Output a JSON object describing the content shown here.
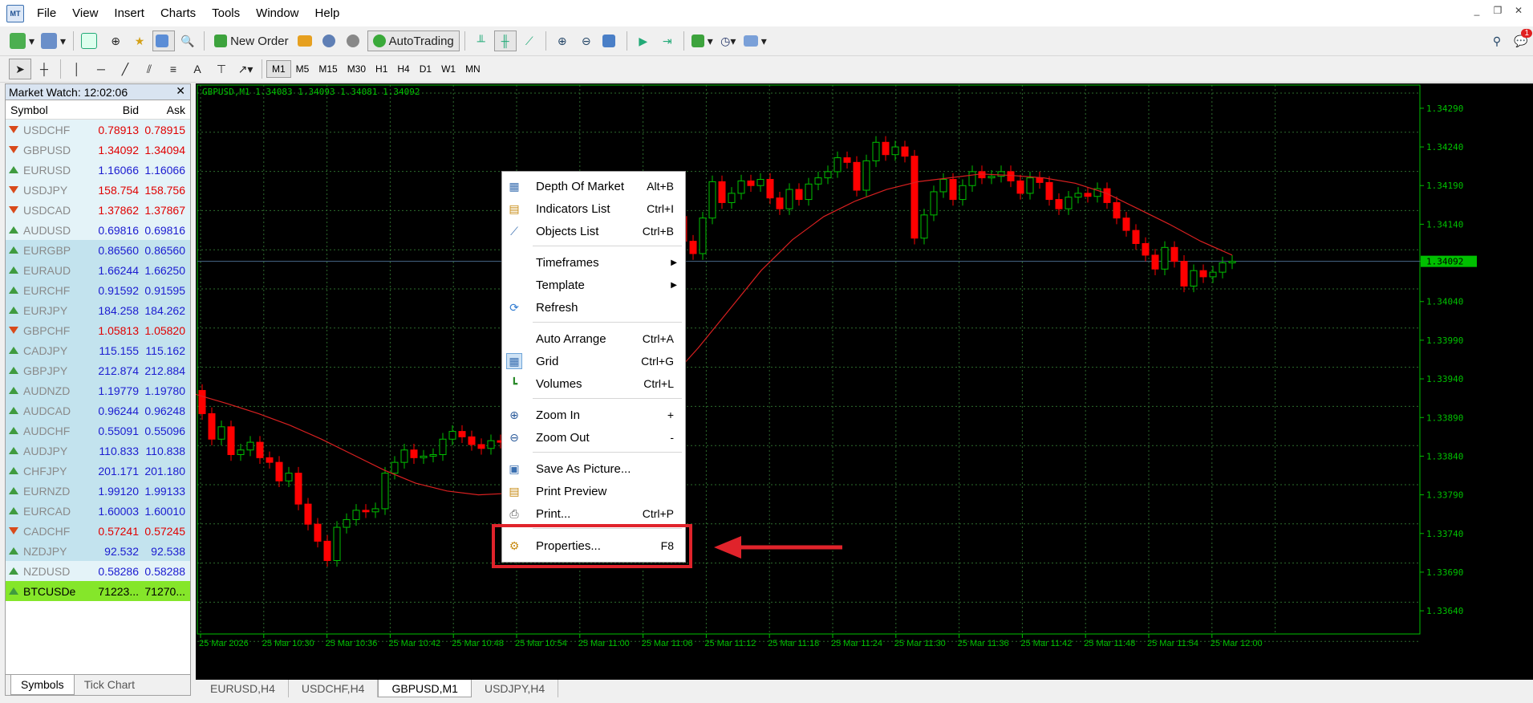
{
  "menubar": {
    "items": [
      "File",
      "View",
      "Insert",
      "Charts",
      "Tools",
      "Window",
      "Help"
    ],
    "window_buttons": [
      "_",
      "❐",
      "✕"
    ]
  },
  "toolbar": {
    "new_order_label": "New Order",
    "autotrading_label": "AutoTrading",
    "notification_count": "1"
  },
  "timeframes": [
    "M1",
    "M5",
    "M15",
    "M30",
    "H1",
    "H4",
    "D1",
    "W1",
    "MN"
  ],
  "market_watch": {
    "title": "Market Watch: 12:02:06",
    "headers": {
      "symbol": "Symbol",
      "bid": "Bid",
      "ask": "Ask"
    },
    "rows": [
      {
        "symbol": "USDCHF",
        "bid": "0.78913",
        "ask": "0.78915",
        "dir": "down",
        "color": "red",
        "bg": "c-lt"
      },
      {
        "symbol": "GBPUSD",
        "bid": "1.34092",
        "ask": "1.34094",
        "dir": "down",
        "color": "red",
        "bg": "c-lt"
      },
      {
        "symbol": "EURUSD",
        "bid": "1.16066",
        "ask": "1.16066",
        "dir": "up",
        "color": "blue",
        "bg": "c-lt"
      },
      {
        "symbol": "USDJPY",
        "bid": "158.754",
        "ask": "158.756",
        "dir": "down",
        "color": "red",
        "bg": "c-lt"
      },
      {
        "symbol": "USDCAD",
        "bid": "1.37862",
        "ask": "1.37867",
        "dir": "down",
        "color": "red",
        "bg": "c-lt"
      },
      {
        "symbol": "AUDUSD",
        "bid": "0.69816",
        "ask": "0.69816",
        "dir": "up",
        "color": "blue",
        "bg": "c-lt"
      },
      {
        "symbol": "EURGBP",
        "bid": "0.86560",
        "ask": "0.86560",
        "dir": "up",
        "color": "blue",
        "bg": "c-bl"
      },
      {
        "symbol": "EURAUD",
        "bid": "1.66244",
        "ask": "1.66250",
        "dir": "up",
        "color": "blue",
        "bg": "c-bl"
      },
      {
        "symbol": "EURCHF",
        "bid": "0.91592",
        "ask": "0.91595",
        "dir": "up",
        "color": "blue",
        "bg": "c-bl"
      },
      {
        "symbol": "EURJPY",
        "bid": "184.258",
        "ask": "184.262",
        "dir": "up",
        "color": "blue",
        "bg": "c-bl"
      },
      {
        "symbol": "GBPCHF",
        "bid": "1.05813",
        "ask": "1.05820",
        "dir": "down",
        "color": "red",
        "bg": "c-bl"
      },
      {
        "symbol": "CADJPY",
        "bid": "115.155",
        "ask": "115.162",
        "dir": "up",
        "color": "blue",
        "bg": "c-bl"
      },
      {
        "symbol": "GBPJPY",
        "bid": "212.874",
        "ask": "212.884",
        "dir": "up",
        "color": "blue",
        "bg": "c-bl"
      },
      {
        "symbol": "AUDNZD",
        "bid": "1.19779",
        "ask": "1.19780",
        "dir": "up",
        "color": "blue",
        "bg": "c-bl"
      },
      {
        "symbol": "AUDCAD",
        "bid": "0.96244",
        "ask": "0.96248",
        "dir": "up",
        "color": "blue",
        "bg": "c-bl"
      },
      {
        "symbol": "AUDCHF",
        "bid": "0.55091",
        "ask": "0.55096",
        "dir": "up",
        "color": "blue",
        "bg": "c-bl"
      },
      {
        "symbol": "AUDJPY",
        "bid": "110.833",
        "ask": "110.838",
        "dir": "up",
        "color": "blue",
        "bg": "c-bl"
      },
      {
        "symbol": "CHFJPY",
        "bid": "201.171",
        "ask": "201.180",
        "dir": "up",
        "color": "blue",
        "bg": "c-bl"
      },
      {
        "symbol": "EURNZD",
        "bid": "1.99120",
        "ask": "1.99133",
        "dir": "up",
        "color": "blue",
        "bg": "c-bl"
      },
      {
        "symbol": "EURCAD",
        "bid": "1.60003",
        "ask": "1.60010",
        "dir": "up",
        "color": "blue",
        "bg": "c-bl"
      },
      {
        "symbol": "CADCHF",
        "bid": "0.57241",
        "ask": "0.57245",
        "dir": "down",
        "color": "red",
        "bg": "c-bl"
      },
      {
        "symbol": "NZDJPY",
        "bid": "92.532",
        "ask": "92.538",
        "dir": "up",
        "color": "blue",
        "bg": "c-bl"
      },
      {
        "symbol": "NZDUSD",
        "bid": "0.58286",
        "ask": "0.58288",
        "dir": "up",
        "color": "blue",
        "bg": "c-lt"
      },
      {
        "symbol": "BTCUSDe",
        "bid": "71223...",
        "ask": "71270...",
        "dir": "up",
        "color": "black",
        "bg": "c-sel"
      }
    ],
    "tabs": [
      "Symbols",
      "Tick Chart"
    ]
  },
  "chart": {
    "label": "GBPUSD,M1  1.34083 1.34093 1.34081 1.34092",
    "price_labels": [
      "1.34290",
      "1.34240",
      "1.34190",
      "1.34140",
      "1.34092",
      "1.34040",
      "1.33990",
      "1.33940",
      "1.33890",
      "1.33840",
      "1.33790",
      "1.33740",
      "1.33690",
      "1.33640"
    ],
    "current_price": "1.34092",
    "time_labels": [
      "25 Mar 2026",
      "25 Mar 10:30",
      "25 Mar 10:36",
      "25 Mar 10:42",
      "25 Mar 10:48",
      "25 Mar 10:54",
      "25 Mar 11:00",
      "25 Mar 11:06",
      "25 Mar 11:12",
      "25 Mar 11:18",
      "25 Mar 11:24",
      "25 Mar 11:30",
      "25 Mar 11:36",
      "25 Mar 11:42",
      "25 Mar 11:48",
      "25 Mar 11:54",
      "25 Mar 12:00"
    ],
    "colors": {
      "bull": "#00c000",
      "bear": "#ff0000",
      "grid": "#2d6b2d",
      "ma": "#d82020",
      "axis": "#00c000"
    },
    "chart_data": {
      "type": "line",
      "title": "GBPUSD,M1",
      "ylim": [
        1.3361,
        1.3432
      ],
      "candle_closes": [
        1.33895,
        1.33862,
        1.33878,
        1.33842,
        1.33848,
        1.33858,
        1.33838,
        1.33832,
        1.33808,
        1.33818,
        1.33778,
        1.33752,
        1.3373,
        1.33705,
        1.33748,
        1.33758,
        1.3377,
        1.33768,
        1.33772,
        1.33818,
        1.33832,
        1.33848,
        1.33838,
        1.3384,
        1.33842,
        1.33862,
        1.33872,
        1.33865,
        1.33855,
        1.3385,
        1.3386,
        1.33858,
        1.3386,
        1.3388,
        1.339,
        1.33895,
        1.3391,
        1.3393,
        1.33955,
        1.33998,
        1.33978,
        1.33962,
        1.33992,
        1.3405,
        1.3402,
        1.3404,
        1.34075,
        1.34105,
        1.34125,
        1.3415,
        1.34118,
        1.34102,
        1.34148,
        1.34195,
        1.34168,
        1.3418,
        1.34196,
        1.3419,
        1.34198,
        1.34174,
        1.3416,
        1.34185,
        1.34172,
        1.34192,
        1.342,
        1.34208,
        1.34226,
        1.3422,
        1.34184,
        1.34222,
        1.34246,
        1.3423,
        1.3424,
        1.34228,
        1.34122,
        1.34152,
        1.34182,
        1.34198,
        1.34172,
        1.3419,
        1.34208,
        1.342,
        1.34202,
        1.34208,
        1.34196,
        1.3418,
        1.342,
        1.34194,
        1.34172,
        1.3416,
        1.34175,
        1.3418,
        1.34176,
        1.34186,
        1.34168,
        1.34148,
        1.34132,
        1.34115,
        1.341,
        1.34082,
        1.3411,
        1.34092,
        1.3406,
        1.3408,
        1.34072,
        1.34078,
        1.3409,
        1.34092
      ],
      "ma_values": [
        1.3392,
        1.33908,
        1.33895,
        1.3388,
        1.33862,
        1.33842,
        1.33822,
        1.33805,
        1.33795,
        1.3379,
        1.33792,
        1.338,
        1.3382,
        1.3385,
        1.3389,
        1.33935,
        1.3398,
        1.3403,
        1.3408,
        1.3412,
        1.3415,
        1.3417,
        1.34185,
        1.34195,
        1.342,
        1.34205,
        1.34203,
        1.342,
        1.34193,
        1.3418,
        1.3416,
        1.3414,
        1.34118,
        1.341
      ]
    }
  },
  "chart_tabs": [
    "EURUSD,H4",
    "USDCHF,H4",
    "GBPUSD,M1",
    "USDJPY,H4"
  ],
  "context_menu": {
    "items": [
      {
        "label": "Depth Of Market",
        "shortcut": "Alt+B",
        "icon": "depth-of-market-icon"
      },
      {
        "label": "Indicators List",
        "shortcut": "Ctrl+I",
        "icon": "indicators-list-icon"
      },
      {
        "label": "Objects List",
        "shortcut": "Ctrl+B",
        "icon": "objects-list-icon"
      },
      {
        "label": "Timeframes",
        "shortcut": "",
        "icon": "",
        "submenu": true
      },
      {
        "label": "Template",
        "shortcut": "",
        "icon": "",
        "submenu": true
      },
      {
        "label": "Refresh",
        "shortcut": "",
        "icon": "refresh-icon"
      },
      {
        "label": "Auto Arrange",
        "shortcut": "Ctrl+A",
        "icon": ""
      },
      {
        "label": "Grid",
        "shortcut": "Ctrl+G",
        "icon": "grid-icon"
      },
      {
        "label": "Volumes",
        "shortcut": "Ctrl+L",
        "icon": "volumes-icon"
      },
      {
        "label": "Zoom In",
        "shortcut": "+",
        "icon": "zoom-in-icon"
      },
      {
        "label": "Zoom Out",
        "shortcut": "-",
        "icon": "zoom-out-icon"
      },
      {
        "label": "Save As Picture...",
        "shortcut": "",
        "icon": "save-picture-icon"
      },
      {
        "label": "Print Preview",
        "shortcut": "",
        "icon": "print-preview-icon"
      },
      {
        "label": "Print...",
        "shortcut": "Ctrl+P",
        "icon": "print-icon"
      },
      {
        "label": "Properties...",
        "shortcut": "F8",
        "icon": "properties-icon"
      }
    ]
  },
  "annotation_color": "#e0232b"
}
